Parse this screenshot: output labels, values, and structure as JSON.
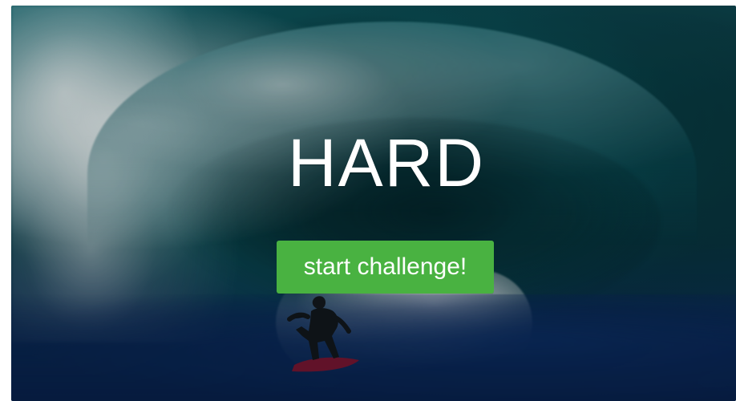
{
  "challenge": {
    "difficulty_label": "HARD",
    "start_button_label": "start challenge!"
  },
  "theme": {
    "accent_green": "#49b241",
    "text_white": "#ffffff"
  },
  "icons": {
    "hero_image": "surfing-wave-photo"
  }
}
